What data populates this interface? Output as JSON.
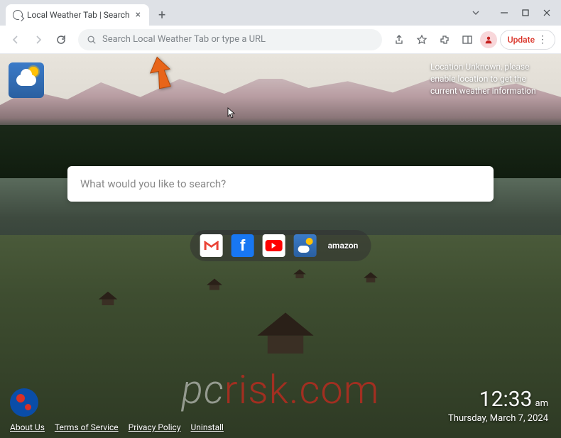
{
  "window": {
    "tab_title": "Local Weather Tab | Search",
    "new_tab_glyph": "+",
    "close_glyph": "×"
  },
  "toolbar": {
    "omnibox_placeholder": "Search Local Weather Tab or type a URL",
    "update_label": "Update"
  },
  "page": {
    "location_msg": "Location Unknown, please enable location to get the current weather information",
    "search_placeholder": "What would you like to search?",
    "quicklinks": {
      "gmail": "M",
      "facebook": "f",
      "amazon": "amazon"
    },
    "footer_links": [
      "About Us",
      "Terms of Service",
      "Privacy Policy",
      "Uninstall"
    ],
    "clock": {
      "time": "12:33",
      "ampm": "am",
      "date": "Thursday, March 7, 2024"
    },
    "watermark_prefix": "pc",
    "watermark_suffix": "risk.com"
  },
  "colors": {
    "accent": "#d93025",
    "link": "#1a73e8"
  }
}
